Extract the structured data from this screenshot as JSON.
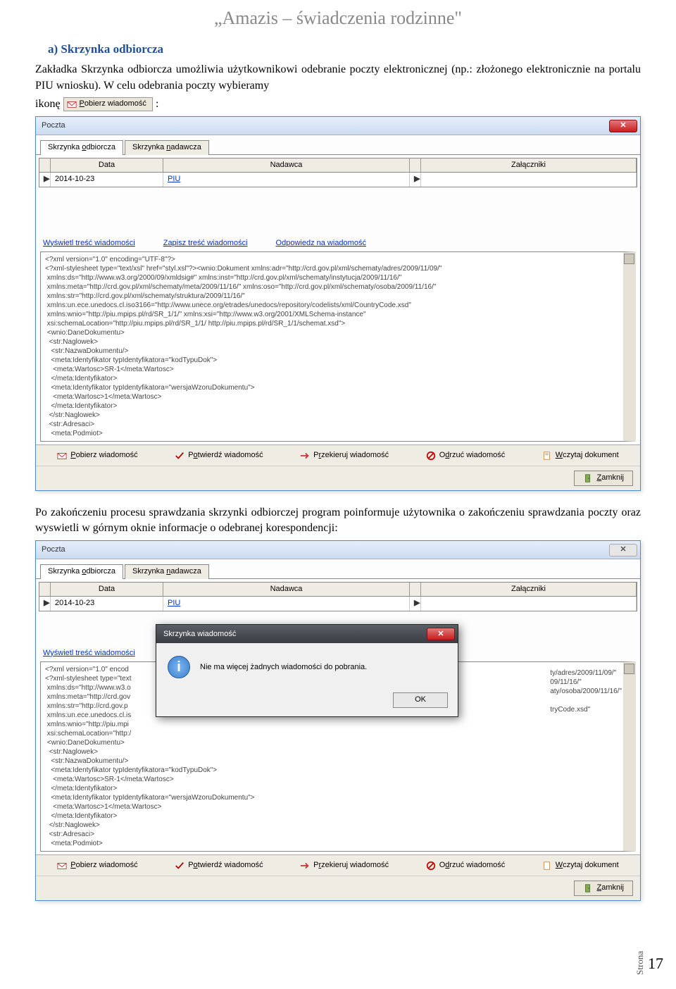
{
  "page_header": "„Amazis – świadczenia rodzinne\"",
  "section_heading": "a)  Skrzynka odbiorcza",
  "intro_p1": "Zakładka Skrzynka odbiorcza umożliwia użytkownikowi odebranie poczty elektronicznej (np.: złożonego elektronicznie na portalu PIU wniosku). W celu odebrania poczty wybieramy",
  "intro_line2_prefix": "ikonę",
  "intro_line2_suffix": ":",
  "pobierz_btn_label": "Pobierz wiadomość",
  "screenshot1": {
    "title": "Poczta",
    "tabs": [
      "Skrzynka odbiorcza",
      "Skrzynka nadawcza"
    ],
    "headers": [
      "Data",
      "Nadawca",
      "Załączniki"
    ],
    "row": {
      "data": "2014-10-23",
      "nadawca": "PIU",
      "zalaczniki": ""
    },
    "links": [
      "Wyświetl treść wiadomości",
      "Zapisz treść wiadomości",
      "Odpowiedz na wiadomość"
    ],
    "xml": "<?xml version=\"1.0\" encoding=\"UTF-8\"?>\n<?xml-stylesheet type=\"text/xsl\" href=\"styl.xsl\"?><wnio:Dokument xmlns:adr=\"http://crd.gov.pl/xml/schematy/adres/2009/11/09/\"\n xmlns:ds=\"http://www.w3.org/2000/09/xmldsig#\" xmlns:inst=\"http://crd.gov.pl/xml/schematy/instytucja/2009/11/16/\"\n xmlns:meta=\"http://crd.gov.pl/xml/schematy/meta/2009/11/16/\" xmlns:oso=\"http://crd.gov.pl/xml/schematy/osoba/2009/11/16/\"\n xmlns:str=\"http://crd.gov.pl/xml/schematy/struktura/2009/11/16/\"\n xmlns:un.ece.unedocs.cl.iso3166=\"http://www.unece.org/etrades/unedocs/repository/codelists/xml/CountryCode.xsd\"\n xmlns:wnio=\"http://piu.mpips.pl/rd/SR_1/1/\" xmlns:xsi=\"http://www.w3.org/2001/XMLSchema-instance\"\n xsi:schemaLocation=\"http://piu.mpips.pl/rd/SR_1/1/ http://piu.mpips.pl/rd/SR_1/1/schemat.xsd\">\n <wnio:DaneDokumentu>\n  <str:Naglowek>\n   <str:NazwaDokumentu/>\n   <meta:Identyfikator typIdentyfikatora=\"kodTypuDok\">\n    <meta:Wartosc>SR-1</meta:Wartosc>\n   </meta:Identyfikator>\n   <meta:Identyfikator typIdentyfikatora=\"wersjaWzoruDokumentu\">\n    <meta:Wartosc>1</meta:Wartosc>\n   </meta:Identyfikator>\n  </str:Naglowek>\n  <str:Adresaci>\n   <meta:Podmiot>",
    "toolbar": [
      {
        "name": "pobierz",
        "label": "Pobierz wiadomość",
        "color": "#c23"
      },
      {
        "name": "potwierdz",
        "label": "Potwierdź wiadomość",
        "color": "#b00"
      },
      {
        "name": "przekieruj",
        "label": "Przekieruj wiadomość",
        "color": "#c33"
      },
      {
        "name": "odrzuc",
        "label": "Odrzuć wiadomość",
        "color": "#c00"
      },
      {
        "name": "wczytaj",
        "label": "Wczytaj dokument",
        "color": "#c84"
      }
    ],
    "zamknij": "Zamknij"
  },
  "between_p": "Po zakończeniu procesu sprawdzania skrzynki odbiorczej program poinformuje użytownika o zakończeniu sprawdzania poczty oraz wyswietli w górnym oknie informacje o odebranej korespondencji:",
  "screenshot2": {
    "title": "Poczta",
    "tabs": [
      "Skrzynka odbiorcza",
      "Skrzynka nadawcza"
    ],
    "headers": [
      "Data",
      "Nadawca",
      "Załączniki"
    ],
    "row": {
      "data": "2014-10-23",
      "nadawca": "PIU",
      "zalaczniki": ""
    },
    "links": [
      "Wyświetl treść wiadomości"
    ],
    "xml": "<?xml version=\"1.0\" encod\n<?xml-stylesheet type=\"text\n xmlns:ds=\"http://www.w3.o\n xmlns:meta=\"http://crd.gov\n xmlns:str=\"http://crd.gov.p\n xmlns:un.ece.unedocs.cl.is\n xmlns:wnio=\"http://piu.mpi\n xsi:schemaLocation=\"http:/\n <wnio:DaneDokumentu>\n  <str:Naglowek>\n   <str:NazwaDokumentu/>\n   <meta:Identyfikator typIdentyfikatora=\"kodTypuDok\">\n    <meta:Wartosc>SR-1</meta:Wartosc>\n   </meta:Identyfikator>\n   <meta:Identyfikator typIdentyfikatora=\"wersjaWzoruDokumentu\">\n    <meta:Wartosc>1</meta:Wartosc>\n   </meta:Identyfikator>\n  </str:Naglowek>\n  <str:Adresaci>\n   <meta:Podmiot>",
    "xml_right_fragments": "ty/adres/2009/11/09/\"\n09/11/16/\"\naty/osoba/2009/11/16/\"\n\ntryCode.xsd\"",
    "dialog": {
      "title": "Skrzynka wiadomość",
      "message": "Nie ma więcej żadnych wiadomości do pobrania.",
      "ok": "OK"
    },
    "toolbar": [
      {
        "name": "pobierz",
        "label": "Pobierz wiadomość",
        "color": "#c23"
      },
      {
        "name": "potwierdz",
        "label": "Potwierdź wiadomość",
        "color": "#b00"
      },
      {
        "name": "przekieruj",
        "label": "Przekieruj wiadomość",
        "color": "#c33"
      },
      {
        "name": "odrzuc",
        "label": "Odrzuć wiadomość",
        "color": "#c00"
      },
      {
        "name": "wczytaj",
        "label": "Wczytaj dokument",
        "color": "#c84"
      }
    ],
    "zamknij": "Zamknij"
  },
  "page_label": "Strona",
  "page_number": "17"
}
